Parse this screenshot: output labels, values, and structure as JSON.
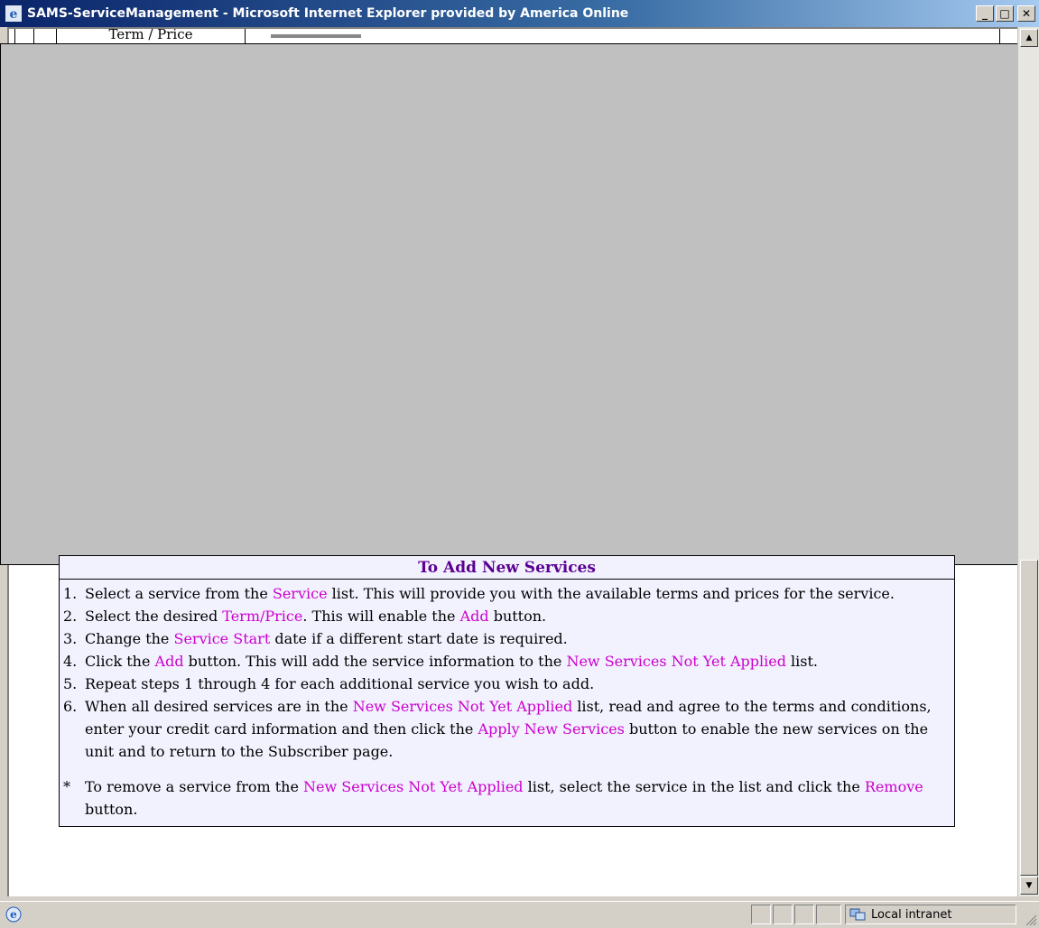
{
  "window": {
    "title": "SAMS-ServiceManagement - Microsoft Internet Explorer provided by America Online",
    "minimize": "_",
    "maximize": "□",
    "close": "✕"
  },
  "page": {
    "partial_header": "Term / Price"
  },
  "instructions": {
    "heading": "To Add New Services",
    "steps": [
      {
        "n": "1.",
        "parts": [
          "Select a service from the ",
          "Service",
          " list. This will provide you with the available terms and prices for the service."
        ]
      },
      {
        "n": "2.",
        "parts": [
          "Select the desired ",
          "Term/Price",
          ". This will enable the ",
          "Add",
          " button."
        ]
      },
      {
        "n": "3.",
        "parts": [
          "Change the ",
          "Service Start",
          " date if a different start date is required."
        ]
      },
      {
        "n": "4.",
        "parts": [
          "Click the ",
          "Add",
          " button. This will add the service information to the ",
          "New Services Not Yet Applied",
          " list."
        ]
      },
      {
        "n": "5.",
        "parts": [
          "Repeat steps 1 through 4 for each additional service you wish to add."
        ]
      },
      {
        "n": "6.",
        "parts": [
          "When all desired services are in the ",
          "New Services Not Yet Applied",
          " list, read and agree to the terms and conditions, enter your credit card information and then click the ",
          "Apply New Services",
          " button to enable the new services on the unit and to return to the Subscriber page."
        ]
      }
    ],
    "note": {
      "n": "*",
      "parts": [
        "To remove a service from the ",
        "New Services Not Yet Applied",
        " list, select the service in the list and click the ",
        "Remove",
        " button."
      ]
    }
  },
  "statusbar": {
    "zone": "Local intranet"
  },
  "colors": {
    "heading": "#5b0091",
    "highlight": "#cc00cc",
    "box_bg": "#f2f2ff",
    "overlay": "#c0c0c0"
  }
}
